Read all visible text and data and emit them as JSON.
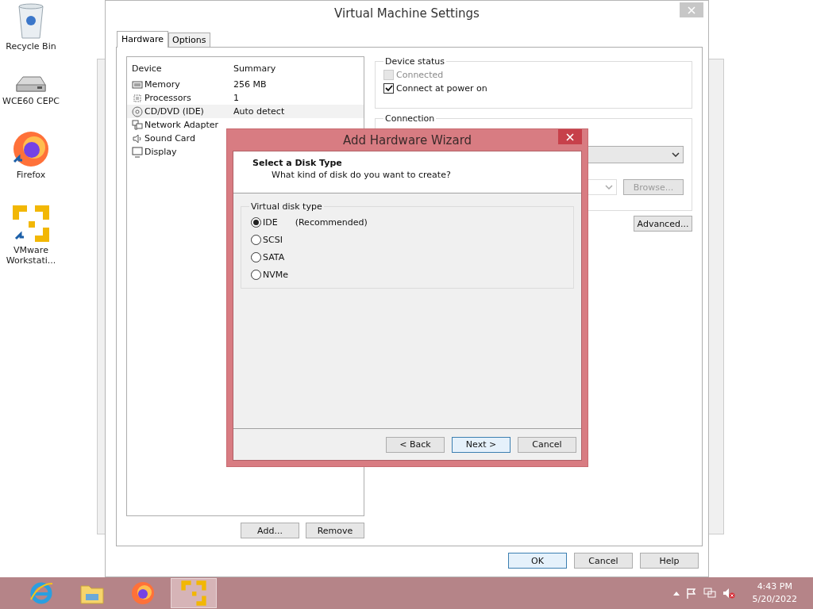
{
  "desktop_icons": [
    {
      "label": "Recycle Bin",
      "kind": "bin"
    },
    {
      "label": "WCE60 CEPC",
      "kind": "drive"
    },
    {
      "label": "Firefox",
      "kind": "firefox"
    },
    {
      "label": "VMware Workstati...",
      "kind": "vmware"
    }
  ],
  "settings_window": {
    "title": "Virtual Machine Settings",
    "tabs": [
      {
        "label": "Hardware",
        "selected": true
      },
      {
        "label": "Options",
        "selected": false
      }
    ],
    "device_table": {
      "columns": [
        "Device",
        "Summary"
      ],
      "rows": [
        {
          "device": "Memory",
          "summary": "256 MB",
          "kind": "memory",
          "selected": false
        },
        {
          "device": "Processors",
          "summary": "1",
          "kind": "cpu",
          "selected": false
        },
        {
          "device": "CD/DVD (IDE)",
          "summary": "Auto detect",
          "kind": "disc",
          "selected": true
        },
        {
          "device": "Network Adapter",
          "kind": "network",
          "selected": false
        },
        {
          "device": "Sound Card",
          "kind": "sound",
          "selected": false
        },
        {
          "device": "Display",
          "kind": "display",
          "selected": false
        }
      ]
    },
    "device_status": {
      "legend": "Device status",
      "options": [
        {
          "label": "Connected",
          "checked": false,
          "disabled": true
        },
        {
          "label": "Connect at power on",
          "checked": true,
          "disabled": false
        }
      ]
    },
    "connection": {
      "legend": "Connection",
      "browse": "Browse...",
      "advanced": "Advanced..."
    },
    "list_buttons": [
      "Add...",
      "Remove"
    ],
    "buttons": [
      {
        "label": "OK",
        "default": true
      },
      {
        "label": "Cancel",
        "default": false
      },
      {
        "label": "Help",
        "default": false
      }
    ]
  },
  "wizard": {
    "title": "Add Hardware Wizard",
    "heading": "Select a Disk Type",
    "subheading": "What kind of disk do you want to create?",
    "group": "Virtual disk type",
    "options": [
      {
        "label": "IDE",
        "note": "(Recommended)",
        "selected": true
      },
      {
        "label": "SCSI",
        "selected": false
      },
      {
        "label": "SATA",
        "selected": false
      },
      {
        "label": "NVMe",
        "selected": false
      }
    ],
    "buttons": [
      {
        "label": "< Back",
        "default": false
      },
      {
        "label": "Next >",
        "default": true
      },
      {
        "label": "Cancel",
        "default": false
      }
    ]
  },
  "taskbar": {
    "apps": [
      {
        "kind": "ie",
        "selected": false
      },
      {
        "kind": "explorer",
        "selected": false
      },
      {
        "kind": "firefox",
        "selected": false
      },
      {
        "kind": "vmware",
        "selected": true
      }
    ],
    "time": "4:43 PM",
    "date": "5/20/2022"
  }
}
